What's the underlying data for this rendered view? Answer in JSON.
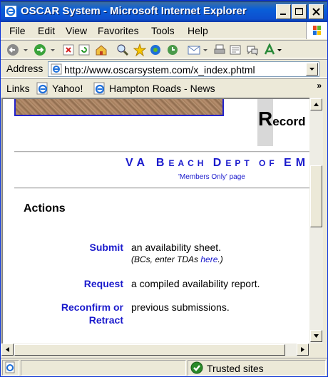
{
  "window": {
    "title": "OSCAR System - Microsoft Internet Explorer"
  },
  "menu": {
    "items": [
      "File",
      "Edit",
      "View",
      "Favorites",
      "Tools",
      "Help"
    ]
  },
  "address": {
    "label": "Address",
    "url": "http://www.oscarsystem.com/x_index.phtml"
  },
  "links": {
    "label": "Links",
    "items": [
      "Yahoo!",
      "Hampton Roads - News"
    ]
  },
  "page": {
    "record_initial": "R",
    "record_rest": "ecord",
    "dept": {
      "parts": [
        {
          "big": "VA ",
          "small": ""
        },
        {
          "big": "B",
          "small": "EACH "
        },
        {
          "big": "D",
          "small": "EPT OF "
        },
        {
          "big": "EMS",
          "small": ""
        }
      ]
    },
    "members_note": "'Members Only' page",
    "actions_heading": "Actions",
    "actions": [
      {
        "link": "Submit",
        "desc": "an availability sheet.",
        "note_pre": "(BCs, enter TDAs ",
        "note_link": "here",
        "note_post": ".)"
      },
      {
        "link": "Request",
        "desc": "a compiled availability report."
      },
      {
        "link": "Reconfirm or",
        "link2": "Retract",
        "desc": "previous submissions."
      }
    ]
  },
  "status": {
    "zone": "Trusted sites"
  },
  "colors": {
    "link_blue": "#1a1acc",
    "titlebar": "#0a5fd8"
  }
}
